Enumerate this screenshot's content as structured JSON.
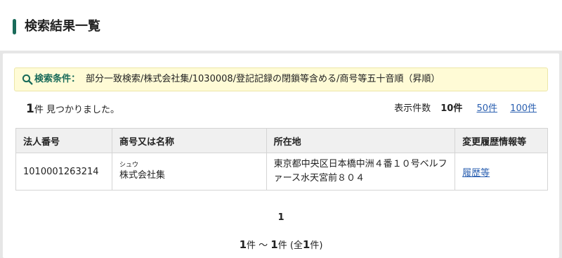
{
  "header": {
    "title": "検索結果一覧"
  },
  "conditions": {
    "label": "検索条件：",
    "text": "部分一致検索/株式会社集/1030008/登記記録の閉鎖等含める/商号等五十音順（昇順）"
  },
  "summary": {
    "count": "1",
    "count_suffix": "件 見つかりました。"
  },
  "per_page": {
    "label": "表示件数",
    "current": "10件",
    "options": [
      "50件",
      "100件"
    ]
  },
  "table": {
    "headers": [
      "法人番号",
      "商号又は名称",
      "所在地",
      "変更履歴情報等"
    ],
    "rows": [
      {
        "corp_number": "1010001263214",
        "kana": "シュウ",
        "name": "株式会社集",
        "address_line1": "東京都中央区日本橋中洲４番１０号ベルフ",
        "address_line2": "ァース水天宮前８０４",
        "history": "履歴等"
      }
    ]
  },
  "pagination": {
    "current_page": "1",
    "start": "1",
    "start_suffix": "件 ～ ",
    "end": "1",
    "end_suffix": "件 (全",
    "total": "1",
    "total_suffix": "件)"
  },
  "colors": {
    "accent": "#1a6b5a",
    "link": "#2a5fb0",
    "condition_bg": "#fffbd6"
  }
}
